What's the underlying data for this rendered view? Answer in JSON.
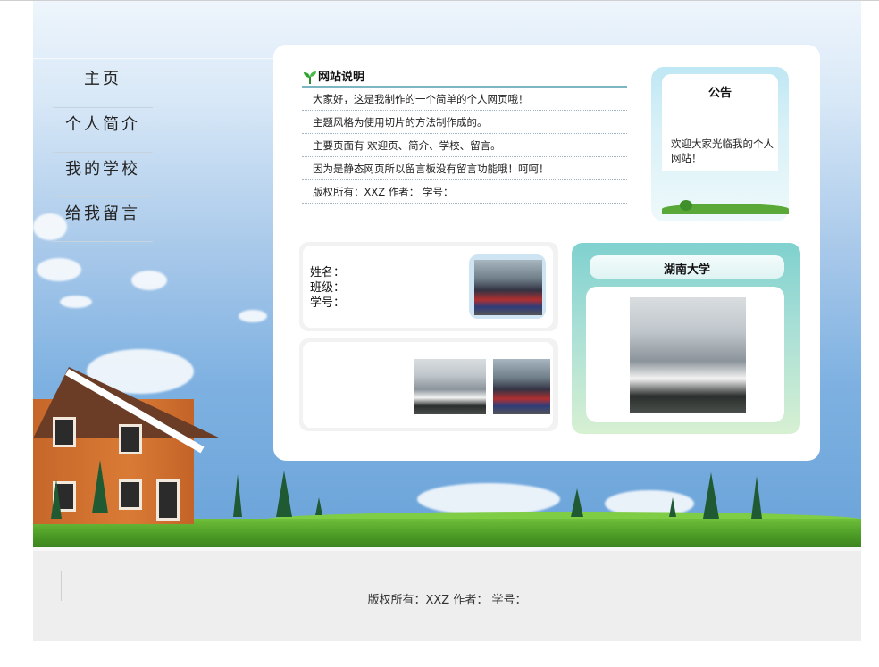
{
  "nav": {
    "items": [
      {
        "label": "主页"
      },
      {
        "label": "个人简介"
      },
      {
        "label": "我的学校"
      },
      {
        "label": "给我留言"
      }
    ]
  },
  "intro": {
    "title": "网站说明",
    "lines": [
      "大家好，这是我制作的一个简单的个人网页哦！",
      "主题风格为使用切片的方法制作成的。",
      "主要页面有 欢迎页、简介、学校、留言。",
      "因为是静态网页所以留言板没有留言功能哦！呵呵！",
      "版权所有：XXZ 作者： 学号："
    ]
  },
  "notice": {
    "title": "公告",
    "text": "欢迎大家光临我的个人网站！"
  },
  "info": {
    "name_label": "姓名：",
    "class_label": "班级：",
    "id_label": "学号："
  },
  "university": {
    "title": "湖南大学"
  },
  "footer": {
    "text": "版权所有：XXZ 作者： 学号："
  },
  "colors": {
    "sky_top": "#eef5fc",
    "sky_bottom": "#6aa3d9",
    "grass": "#4b9a25",
    "intro_rule": "#7bb6c2",
    "uni_box": "#7fd1cf",
    "footer_bg": "#eeeeee"
  }
}
